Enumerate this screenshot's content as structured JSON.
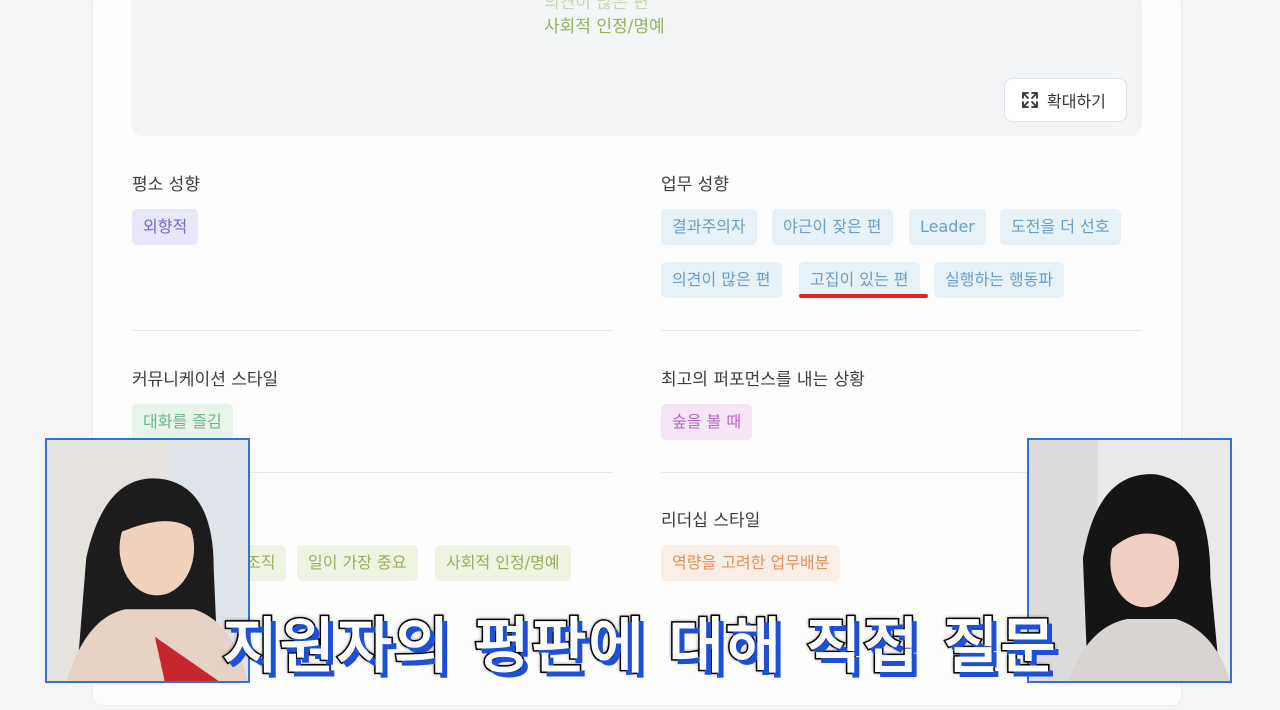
{
  "hero": {
    "faded_text": "의견이 많은 편",
    "text": "사회적 인정/명예",
    "zoom_label": "확대하기"
  },
  "personality": {
    "title": "평소 성향",
    "tags": [
      "외향적"
    ]
  },
  "work": {
    "title": "업무 성향",
    "tags": [
      "결과주의자",
      "야근이 잦은 편",
      "Leader",
      "도전을 더 선호",
      "의견이 많은 편",
      "고집이 있는 편",
      "실행하는 행동파"
    ]
  },
  "communication": {
    "title": "커뮤니케이션 스타일",
    "tags": [
      "대화를 즐김"
    ]
  },
  "performance": {
    "title": "최고의 퍼포먼스를 내는 상황",
    "tags": [
      "숲을 볼 때"
    ]
  },
  "values": {
    "tags": [
      "조직",
      "일이 가장 중요",
      "사회적 인정/명예"
    ]
  },
  "leadership": {
    "title": "리더십 스타일",
    "tags": [
      "역량을 고려한 업무배분"
    ]
  },
  "caption": "지원자의 평판에 대해 직접 질문",
  "colors": {
    "underline": "#e8202a",
    "cam_border": "#2f73d6",
    "caption_shadow": "#1d4fd8"
  }
}
